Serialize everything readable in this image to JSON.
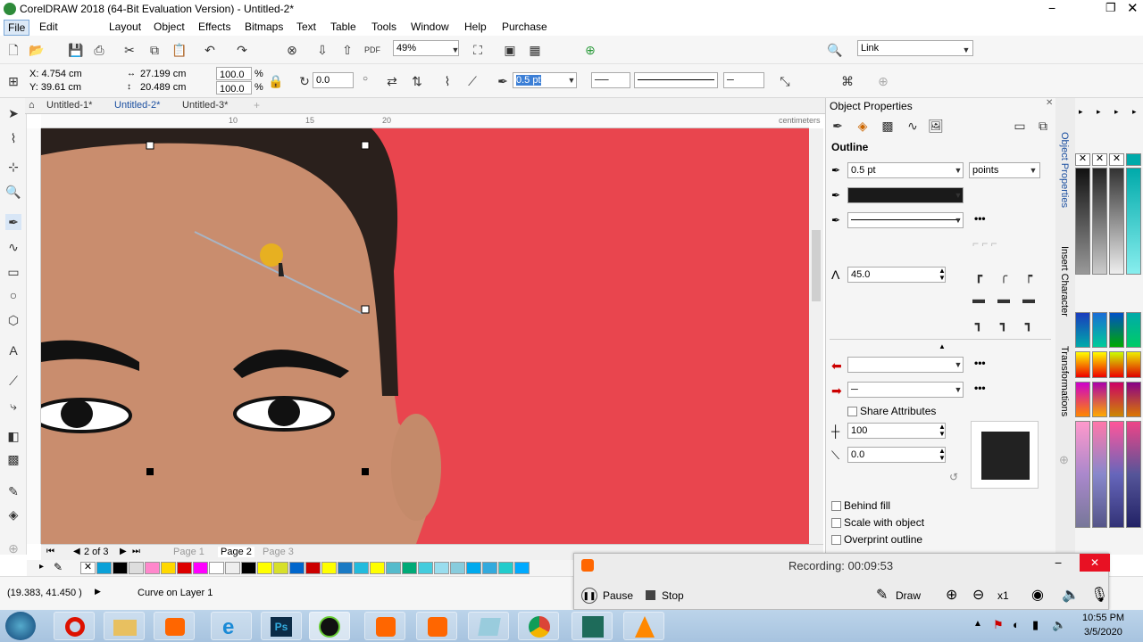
{
  "window": {
    "title": "CorelDRAW 2018 (64-Bit Evaluation Version) - Untitled-2*"
  },
  "menu": [
    "File",
    "Edit",
    "Layout",
    "Object",
    "Effects",
    "Bitmaps",
    "Text",
    "Table",
    "Tools",
    "Window",
    "Help",
    "Purchase"
  ],
  "toolbar": {
    "zoom": "49%",
    "snap_label": "Link"
  },
  "propbar": {
    "x": "X: 4.754 cm",
    "y": "Y: 39.61 cm",
    "w": "27.199 cm",
    "h": "20.489 cm",
    "scale_x": "100.0",
    "scale_y": "100.0",
    "pct": "%",
    "angle": "0.0",
    "outline_width": "0.5 pt"
  },
  "doc_tabs": [
    "Untitled-1*",
    "Untitled-2*",
    "Untitled-3*"
  ],
  "ruler": {
    "ticks": [
      "10",
      "15",
      "20"
    ],
    "unit": "centimeters"
  },
  "page_nav": {
    "counter": "2 of 3",
    "pages": [
      "Page 1",
      "Page 2",
      "Page 3"
    ]
  },
  "status": {
    "coords": "(19.383, 41.450 )",
    "object": "Curve on Layer 1"
  },
  "docker": {
    "title": "Object Properties",
    "section": "Outline",
    "width_value": "0.5 pt",
    "units": "points",
    "miter": "45.0",
    "share_attributes": "Share Attributes",
    "stretch": "100",
    "angle": "0.0",
    "behind_fill": "Behind fill",
    "scale_with_object": "Scale with object",
    "overprint": "Overprint outline"
  },
  "docker_tabs": [
    "Object Properties",
    "Insert Character",
    "Transformations"
  ],
  "recorder": {
    "status": "Recording:  00:09:53",
    "pause": "Pause",
    "stop": "Stop",
    "draw": "Draw",
    "zoom": "x1"
  },
  "clock": {
    "time": "10:55 PM",
    "date": "3/5/2020"
  },
  "colors": {
    "accent": "#1b4fa0",
    "canvas_bg": "#e9454e",
    "recorder_close": "#e81123"
  }
}
